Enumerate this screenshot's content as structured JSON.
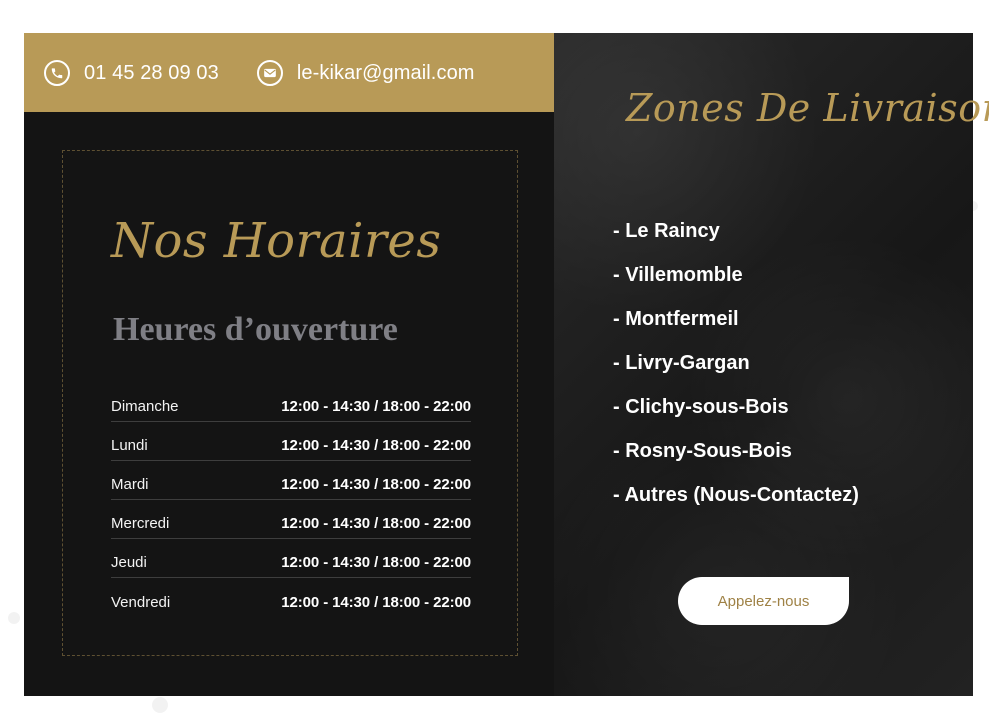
{
  "topbar": {
    "phone": "01 45 28 09 03",
    "email": "le-kikar@gmail.com",
    "phone_icon": "phone-icon",
    "email_icon": "mail-icon",
    "accent_color": "#b89a57"
  },
  "schedule": {
    "title": "Nos Horaires",
    "subtitle": "Heures d’ouverture",
    "rows": [
      {
        "day": "Dimanche",
        "time": "12:00 - 14:30 / 18:00 - 22:00"
      },
      {
        "day": "Lundi",
        "time": "12:00 - 14:30 / 18:00 - 22:00"
      },
      {
        "day": "Mardi",
        "time": "12:00 - 14:30 / 18:00 - 22:00"
      },
      {
        "day": "Mercredi",
        "time": "12:00 - 14:30 / 18:00 - 22:00"
      },
      {
        "day": "Jeudi",
        "time": "12:00 - 14:30 / 18:00 - 22:00"
      },
      {
        "day": "Vendredi",
        "time": "12:00 - 14:30 / 18:00 - 22:00"
      }
    ]
  },
  "delivery": {
    "title": "Zones De Livraison",
    "zones": [
      "- Le Raincy",
      "- Villemomble",
      "- Montfermeil",
      "- Livry-Gargan",
      "- Clichy-sous-Bois",
      "- Rosny-Sous-Bois",
      "- Autres (Nous-Contactez)"
    ],
    "button_label": "Appelez-nous"
  }
}
